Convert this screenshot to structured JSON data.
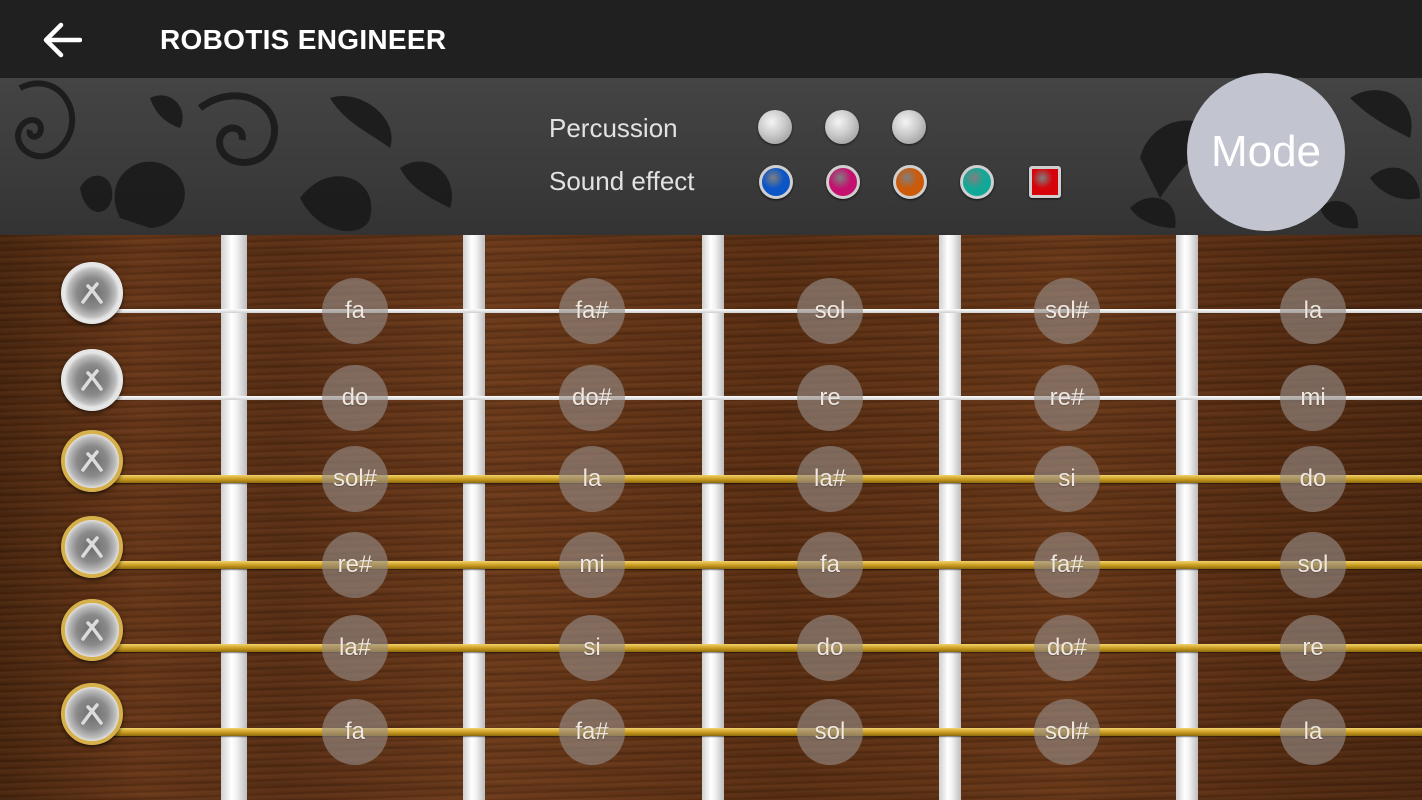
{
  "appbar": {
    "title": "ROBOTIS ENGINEER",
    "back_icon": "arrow-left-icon"
  },
  "panel": {
    "percussion_label": "Percussion",
    "sound_effect_label": "Sound effect",
    "percussion_buttons": 3,
    "sound_effect_colors": [
      "#0b55c7",
      "#c4106f",
      "#cc5a08",
      "#12a897",
      "#d4040a"
    ],
    "mode_label": "Mode"
  },
  "fretboard": {
    "strings": [
      {
        "type": "silver",
        "notes": [
          "fa",
          "fa#",
          "sol",
          "sol#",
          "la"
        ]
      },
      {
        "type": "silver",
        "notes": [
          "do",
          "do#",
          "re",
          "re#",
          "mi"
        ]
      },
      {
        "type": "gold",
        "notes": [
          "sol#",
          "la",
          "la#",
          "si",
          "do"
        ]
      },
      {
        "type": "gold",
        "notes": [
          "re#",
          "mi",
          "fa",
          "fa#",
          "sol"
        ]
      },
      {
        "type": "gold",
        "notes": [
          "la#",
          "si",
          "do",
          "do#",
          "re"
        ]
      },
      {
        "type": "gold",
        "notes": [
          "fa",
          "fa#",
          "sol",
          "sol#",
          "la"
        ]
      }
    ]
  }
}
